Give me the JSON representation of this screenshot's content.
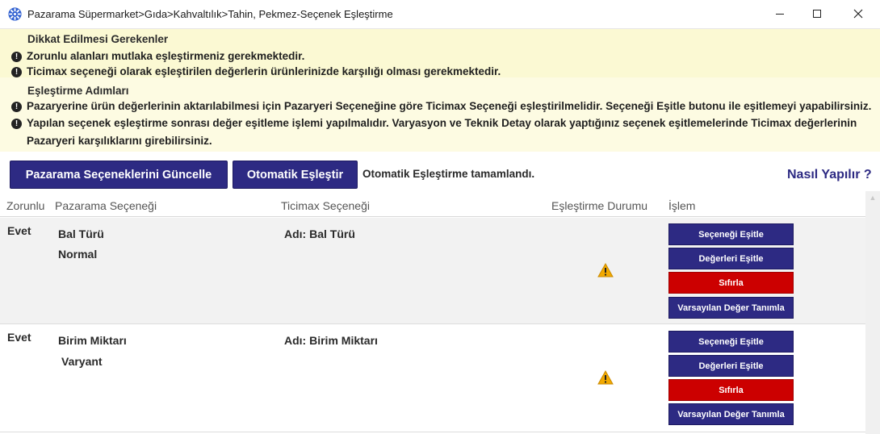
{
  "window": {
    "title": "Pazarama Süpermarket>Gıda>Kahvaltılık>Tahin, Pekmez-Seçenek Eşleştirme",
    "icon": "gear-icon"
  },
  "notice_important": {
    "heading": "Dikkat Edilmesi Gerekenler",
    "lines": [
      "Zorunlu alanları mutlaka eşleştirmeniz gerekmektedir.",
      "Ticimax seçeneği olarak eşleştirilen değerlerin ürünlerinizde karşılığı olması gerekmektedir."
    ]
  },
  "notice_steps": {
    "heading": "Eşleştirme Adımları",
    "lines": [
      "Pazaryerine ürün değerlerinin aktarılabilmesi için Pazaryeri Seçeneğine göre Ticimax Seçeneği eşleştirilmelidir. Seçeneği Eşitle butonu ile eşitlemeyi yapabilirsiniz.",
      "Yapılan seçenek eşleştirme sonrası değer eşitleme işlemi yapılmalıdır. Varyasyon ve Teknik Detay olarak yaptığınız seçenek eşitlemelerinde Ticimax değerlerinin Pazaryeri karşılıklarını girebilirsiniz."
    ]
  },
  "toolbar": {
    "update_label": "Pazarama Seçeneklerini Güncelle",
    "auto_label": "Otomatik Eşleştir",
    "status": "Otomatik Eşleştirme tamamlandı.",
    "help": "Nasıl Yapılır ?"
  },
  "table": {
    "columns": [
      "Zorunlu",
      "Pazarama Seçeneği",
      "Ticimax Seçeneği",
      "Eşleştirme Durumu",
      "İşlem"
    ],
    "rows": [
      {
        "required": "Evet",
        "option_name": "Bal Türü",
        "option_type": "Normal",
        "ticimax": "Adı: Bal Türü",
        "status_icon": "warning-icon",
        "actions": [
          "Seçeneği Eşitle",
          "Değerleri Eşitle",
          "Sıfırla",
          "Varsayılan Değer Tanımla"
        ]
      },
      {
        "required": "Evet",
        "option_name": "Birim Miktarı",
        "option_type": "Varyant",
        "ticimax": "Adı: Birim Miktarı",
        "status_icon": "warning-icon",
        "actions": [
          "Seçeneği Eşitle",
          "Değerleri Eşitle",
          "Sıfırla",
          "Varsayılan Değer Tanımla"
        ]
      }
    ]
  },
  "colors": {
    "primary": "#2d2a83",
    "danger": "#cc0000",
    "notice_bg": "#fbf9d3"
  }
}
